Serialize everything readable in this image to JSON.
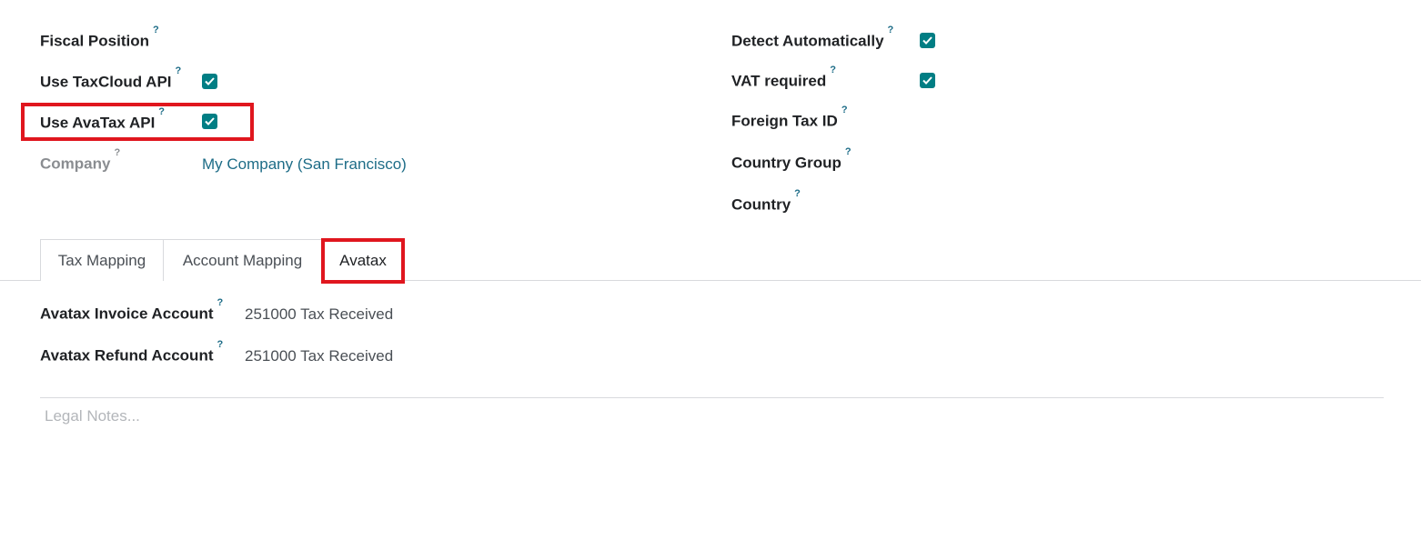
{
  "left_fields": {
    "fiscal_position": {
      "label": "Fiscal Position",
      "help": "?"
    },
    "use_taxcloud": {
      "label": "Use TaxCloud API",
      "help": "?",
      "checked": true
    },
    "use_avatax": {
      "label": "Use AvaTax API",
      "help": "?",
      "checked": true
    },
    "company": {
      "label": "Company",
      "help": "?",
      "value": "My Company (San Francisco)"
    }
  },
  "right_fields": {
    "detect_automatically": {
      "label": "Detect Automatically",
      "help": "?",
      "checked": true
    },
    "vat_required": {
      "label": "VAT required",
      "help": "?",
      "checked": true
    },
    "foreign_tax_id": {
      "label": "Foreign Tax ID",
      "help": "?"
    },
    "country_group": {
      "label": "Country Group",
      "help": "?"
    },
    "country": {
      "label": "Country",
      "help": "?"
    }
  },
  "tabs": [
    {
      "label": "Tax Mapping",
      "active": false
    },
    {
      "label": "Account Mapping",
      "active": false
    },
    {
      "label": "Avatax",
      "active": true
    }
  ],
  "avatax_tab": {
    "invoice_account": {
      "label": "Avatax Invoice Account",
      "help": "?",
      "value": "251000 Tax Received"
    },
    "refund_account": {
      "label": "Avatax Refund Account",
      "help": "?",
      "value": "251000 Tax Received"
    }
  },
  "legal_notes": {
    "placeholder": "Legal Notes..."
  },
  "colors": {
    "accent": "#017e84",
    "highlight": "#e0161e",
    "link": "#1d6c87"
  }
}
